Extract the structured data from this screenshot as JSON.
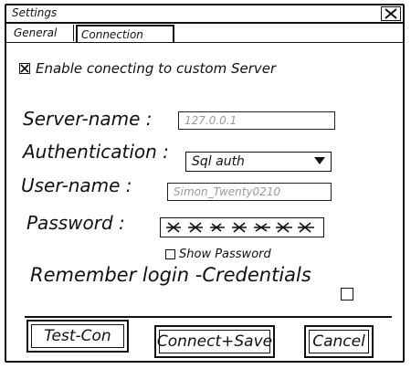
{
  "window": {
    "title": "Settings"
  },
  "tabs": [
    {
      "label": "General"
    },
    {
      "label": "Connection",
      "active": true
    }
  ],
  "enable_custom": {
    "label": "Enable conecting to custom Server",
    "checked": true
  },
  "server": {
    "label": "Server-name :",
    "placeholder": "127.0.0.1"
  },
  "auth": {
    "label": "Authentication :",
    "value": "Sql auth"
  },
  "user": {
    "label": "User-name :",
    "placeholder": "Simon_Twenty0210"
  },
  "password": {
    "label": "Password :",
    "masked": true
  },
  "show_password": {
    "label": "Show Password",
    "checked": false
  },
  "remember": {
    "label": "Remember login -Credentials",
    "checked": false
  },
  "buttons": {
    "test": "Test-Con",
    "connect_save": "Connect+Save",
    "cancel": "Cancel"
  },
  "icons": {
    "close": "close-icon",
    "check": "check-mark-icon",
    "dropdown": "chevron-down-icon"
  }
}
